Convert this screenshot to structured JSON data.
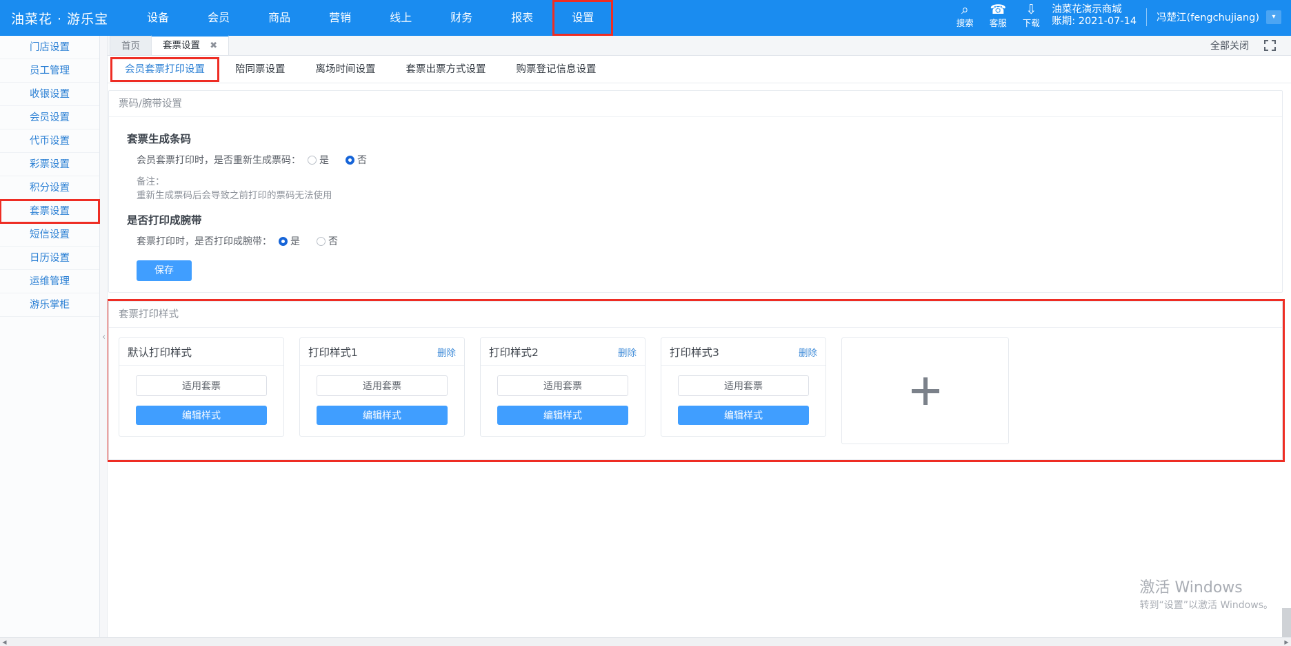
{
  "topnav": {
    "logo": "油菜花 · 游乐宝",
    "items": [
      {
        "label": "设备",
        "boxed": false
      },
      {
        "label": "会员",
        "boxed": false
      },
      {
        "label": "商品",
        "boxed": false
      },
      {
        "label": "营销",
        "boxed": false
      },
      {
        "label": "线上",
        "boxed": false
      },
      {
        "label": "财务",
        "boxed": false
      },
      {
        "label": "报表",
        "boxed": false
      },
      {
        "label": "设置",
        "boxed": true
      }
    ],
    "tools": [
      {
        "icon": "search-icon",
        "glyph": "⌕",
        "label": "搜索"
      },
      {
        "icon": "headset-icon",
        "glyph": "☎",
        "label": "客服"
      },
      {
        "icon": "download-icon",
        "glyph": "⇩",
        "label": "下载"
      }
    ],
    "shop_name": "油菜花演示商城",
    "account_period": "账期: 2021-07-14",
    "user": "冯楚江(fengchujiang)",
    "caret": "▾"
  },
  "sidebar": {
    "items": [
      {
        "label": "门店设置",
        "selected": false
      },
      {
        "label": "员工管理",
        "selected": false
      },
      {
        "label": "收银设置",
        "selected": false
      },
      {
        "label": "会员设置",
        "selected": false
      },
      {
        "label": "代币设置",
        "selected": false
      },
      {
        "label": "彩票设置",
        "selected": false
      },
      {
        "label": "积分设置",
        "selected": false
      },
      {
        "label": "套票设置",
        "selected": true
      },
      {
        "label": "短信设置",
        "selected": false
      },
      {
        "label": "日历设置",
        "selected": false
      },
      {
        "label": "运维管理",
        "selected": false
      },
      {
        "label": "游乐掌柜",
        "selected": false
      }
    ],
    "collapse_chevron": "‹"
  },
  "tabstrip": {
    "tabs": [
      {
        "label": "首页",
        "active": false,
        "closable": false
      },
      {
        "label": "套票设置",
        "active": true,
        "closable": true
      }
    ],
    "close_glyph": "✖",
    "close_all_label": "全部关闭",
    "fullscreen_icon": "expand-icon"
  },
  "subtabs": [
    {
      "label": "会员套票打印设置",
      "active": true,
      "boxed": true
    },
    {
      "label": "陪同票设置",
      "active": false,
      "boxed": false
    },
    {
      "label": "离场时间设置",
      "active": false,
      "boxed": false
    },
    {
      "label": "套票出票方式设置",
      "active": false,
      "boxed": false
    },
    {
      "label": "购票登记信息设置",
      "active": false,
      "boxed": false
    }
  ],
  "settings_panel": {
    "header": "票码/腕带设置",
    "section1": {
      "title": "套票生成条码",
      "question": "会员套票打印时，是否重新生成票码：",
      "options": [
        {
          "label": "是",
          "checked": false
        },
        {
          "label": "否",
          "checked": true
        }
      ],
      "note_label": "备注：",
      "note_text": "重新生成票码后会导致之前打印的票码无法使用"
    },
    "section2": {
      "title": "是否打印成腕带",
      "question": "套票打印时，是否打印成腕带：",
      "options": [
        {
          "label": "是",
          "checked": true
        },
        {
          "label": "否",
          "checked": false
        }
      ]
    },
    "save_label": "保存"
  },
  "styles_panel": {
    "header": "套票打印样式",
    "boxed": true,
    "delete_label": "删除",
    "apply_label": "适用套票",
    "edit_label": "编辑样式",
    "add_glyph": "+",
    "cards": [
      {
        "title": "默认打印样式",
        "deletable": false
      },
      {
        "title": "打印样式1",
        "deletable": true
      },
      {
        "title": "打印样式2",
        "deletable": true
      },
      {
        "title": "打印样式3",
        "deletable": true
      }
    ]
  },
  "watermark": {
    "line1": "激活 Windows",
    "line2": "转到“设置”以激活 Windows。"
  },
  "scroll": {
    "left_arrow": "◀",
    "right_arrow": "▶"
  },
  "colors": {
    "brand_blue": "#1a8cf0",
    "button_blue": "#409eff",
    "highlight_red": "#ee2d24",
    "link_blue": "#2a7fd4"
  }
}
